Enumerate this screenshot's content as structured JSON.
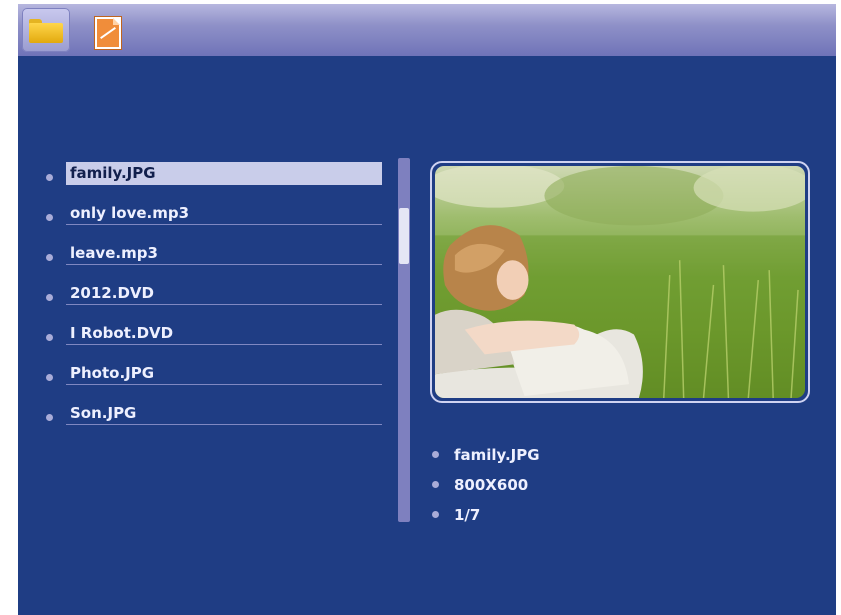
{
  "toolbar": {
    "icons": [
      "folder-icon",
      "photo-icon"
    ]
  },
  "file_list": {
    "selected_index": 0,
    "items": [
      {
        "name": "family.JPG"
      },
      {
        "name": "only love.mp3"
      },
      {
        "name": "leave.mp3"
      },
      {
        "name": "2012.DVD"
      },
      {
        "name": "I Robot.DVD"
      },
      {
        "name": "Photo.JPG"
      },
      {
        "name": "Son.JPG"
      }
    ]
  },
  "preview": {
    "description_icon": "photo-preview"
  },
  "info": {
    "filename": "family.JPG",
    "resolution": "800X600",
    "position": "1/7"
  },
  "colors": {
    "background": "#1f3d84",
    "selection": "#c9cdea",
    "text": "#eef0ff"
  }
}
